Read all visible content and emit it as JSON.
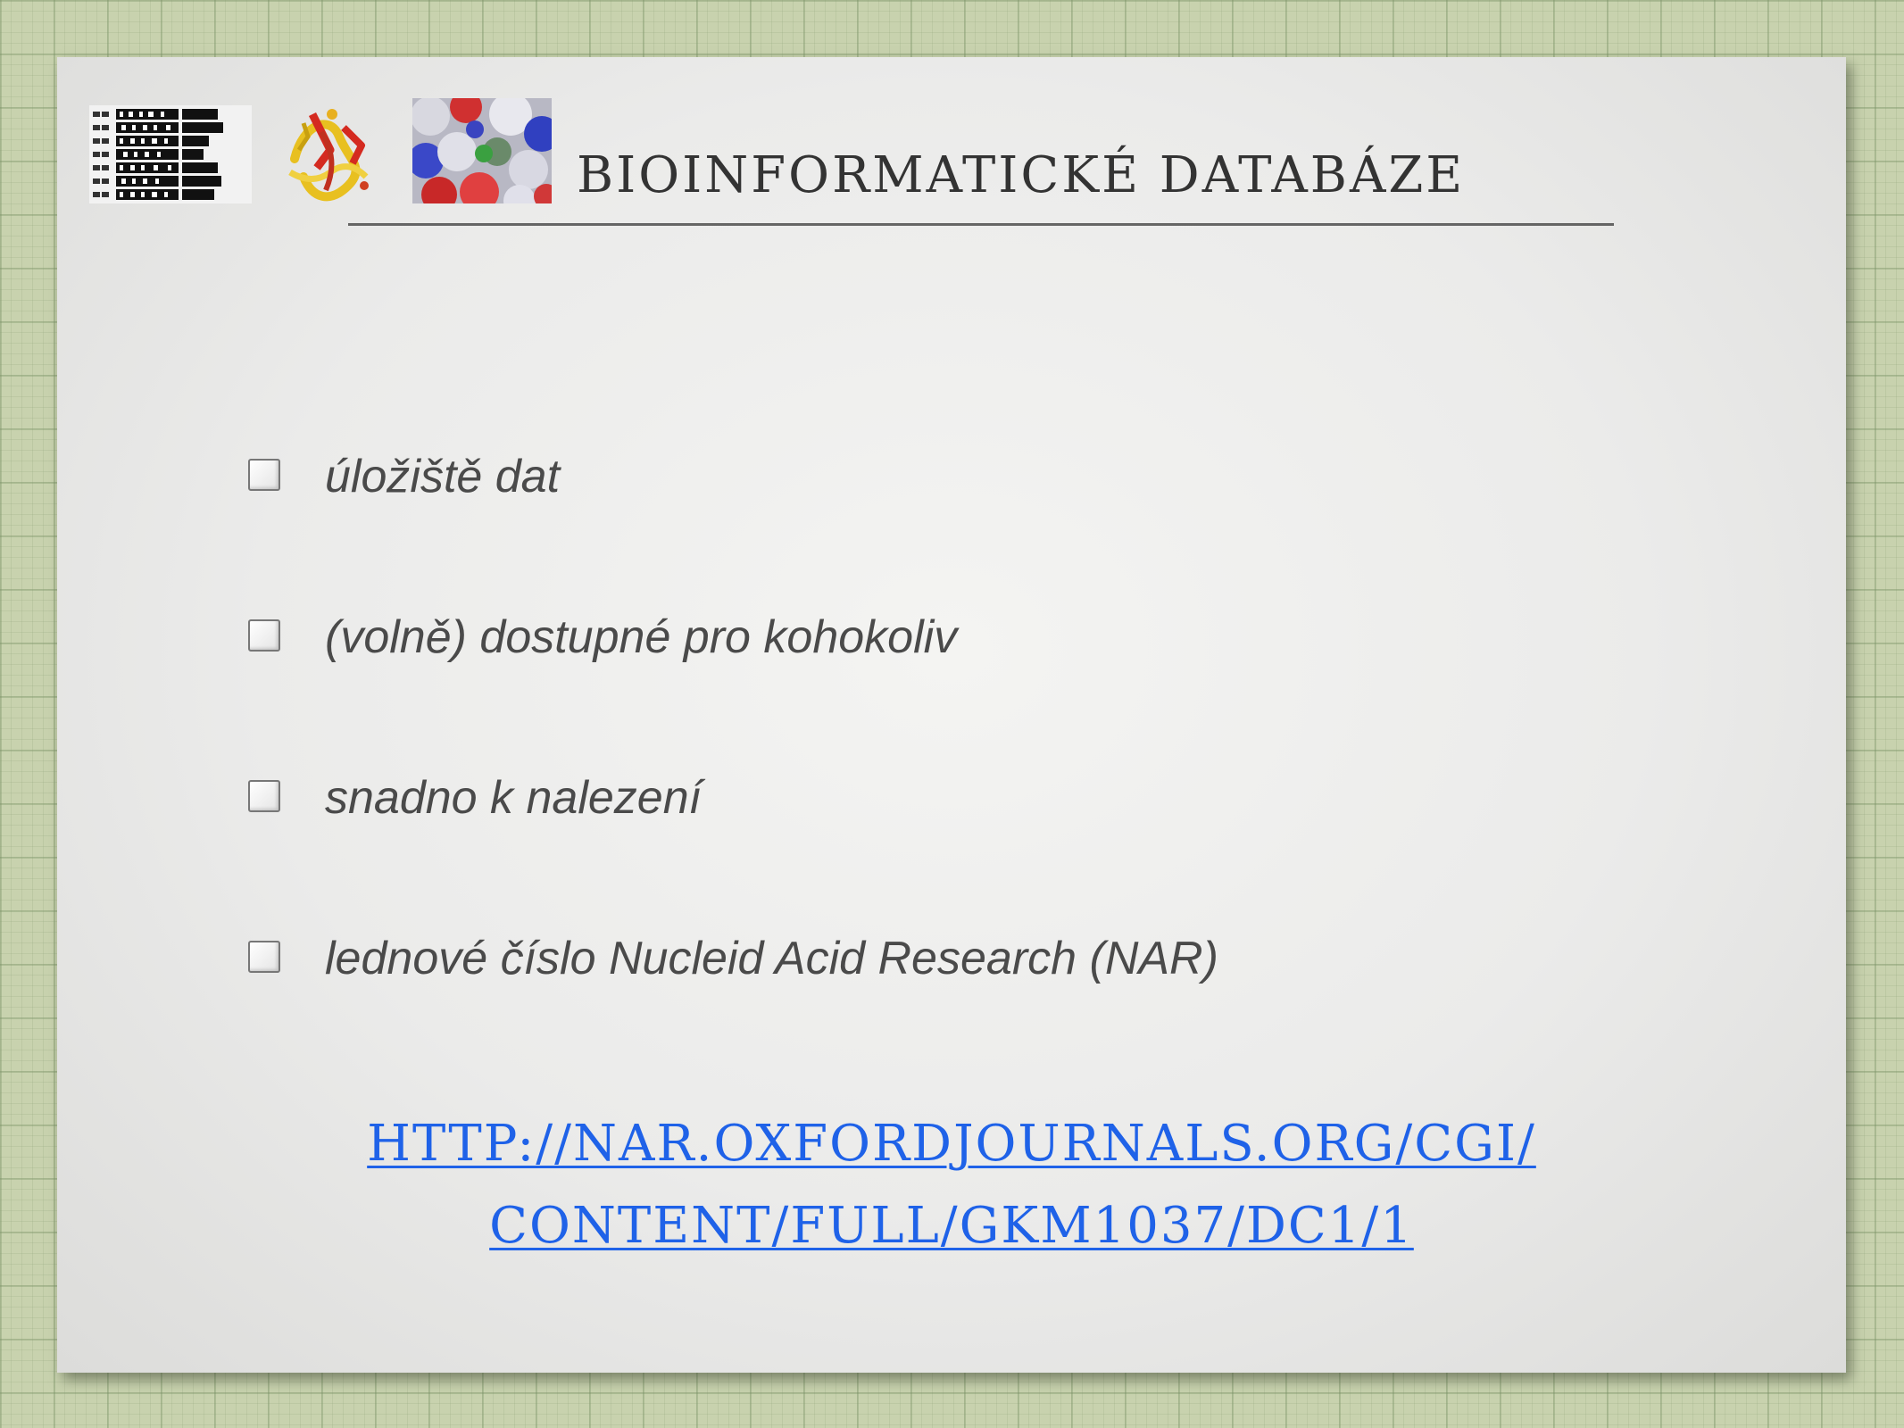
{
  "slide": {
    "title": "BIOINFORMATICKÉ DATABÁZE",
    "bullets": [
      "úložiště dat",
      "(volně) dostupné pro kohokoliv",
      "snadno k nalezení",
      "lednové číslo Nucleid Acid Research (NAR)"
    ],
    "link": {
      "line1": "HTTP://NAR.OXFORDJOURNALS.ORG/CGI/",
      "line2": "CONTENT/FULL/GKM1037/DC1/1"
    }
  },
  "colors": {
    "background": "#c8d2ae",
    "slide": "#ebebea",
    "text": "#4a4a4a",
    "title": "#333333",
    "link": "#1f62e8"
  },
  "icons": [
    "sequence-alignment-image",
    "protein-structure-image",
    "molecular-surface-image",
    "checkbox-icon"
  ]
}
